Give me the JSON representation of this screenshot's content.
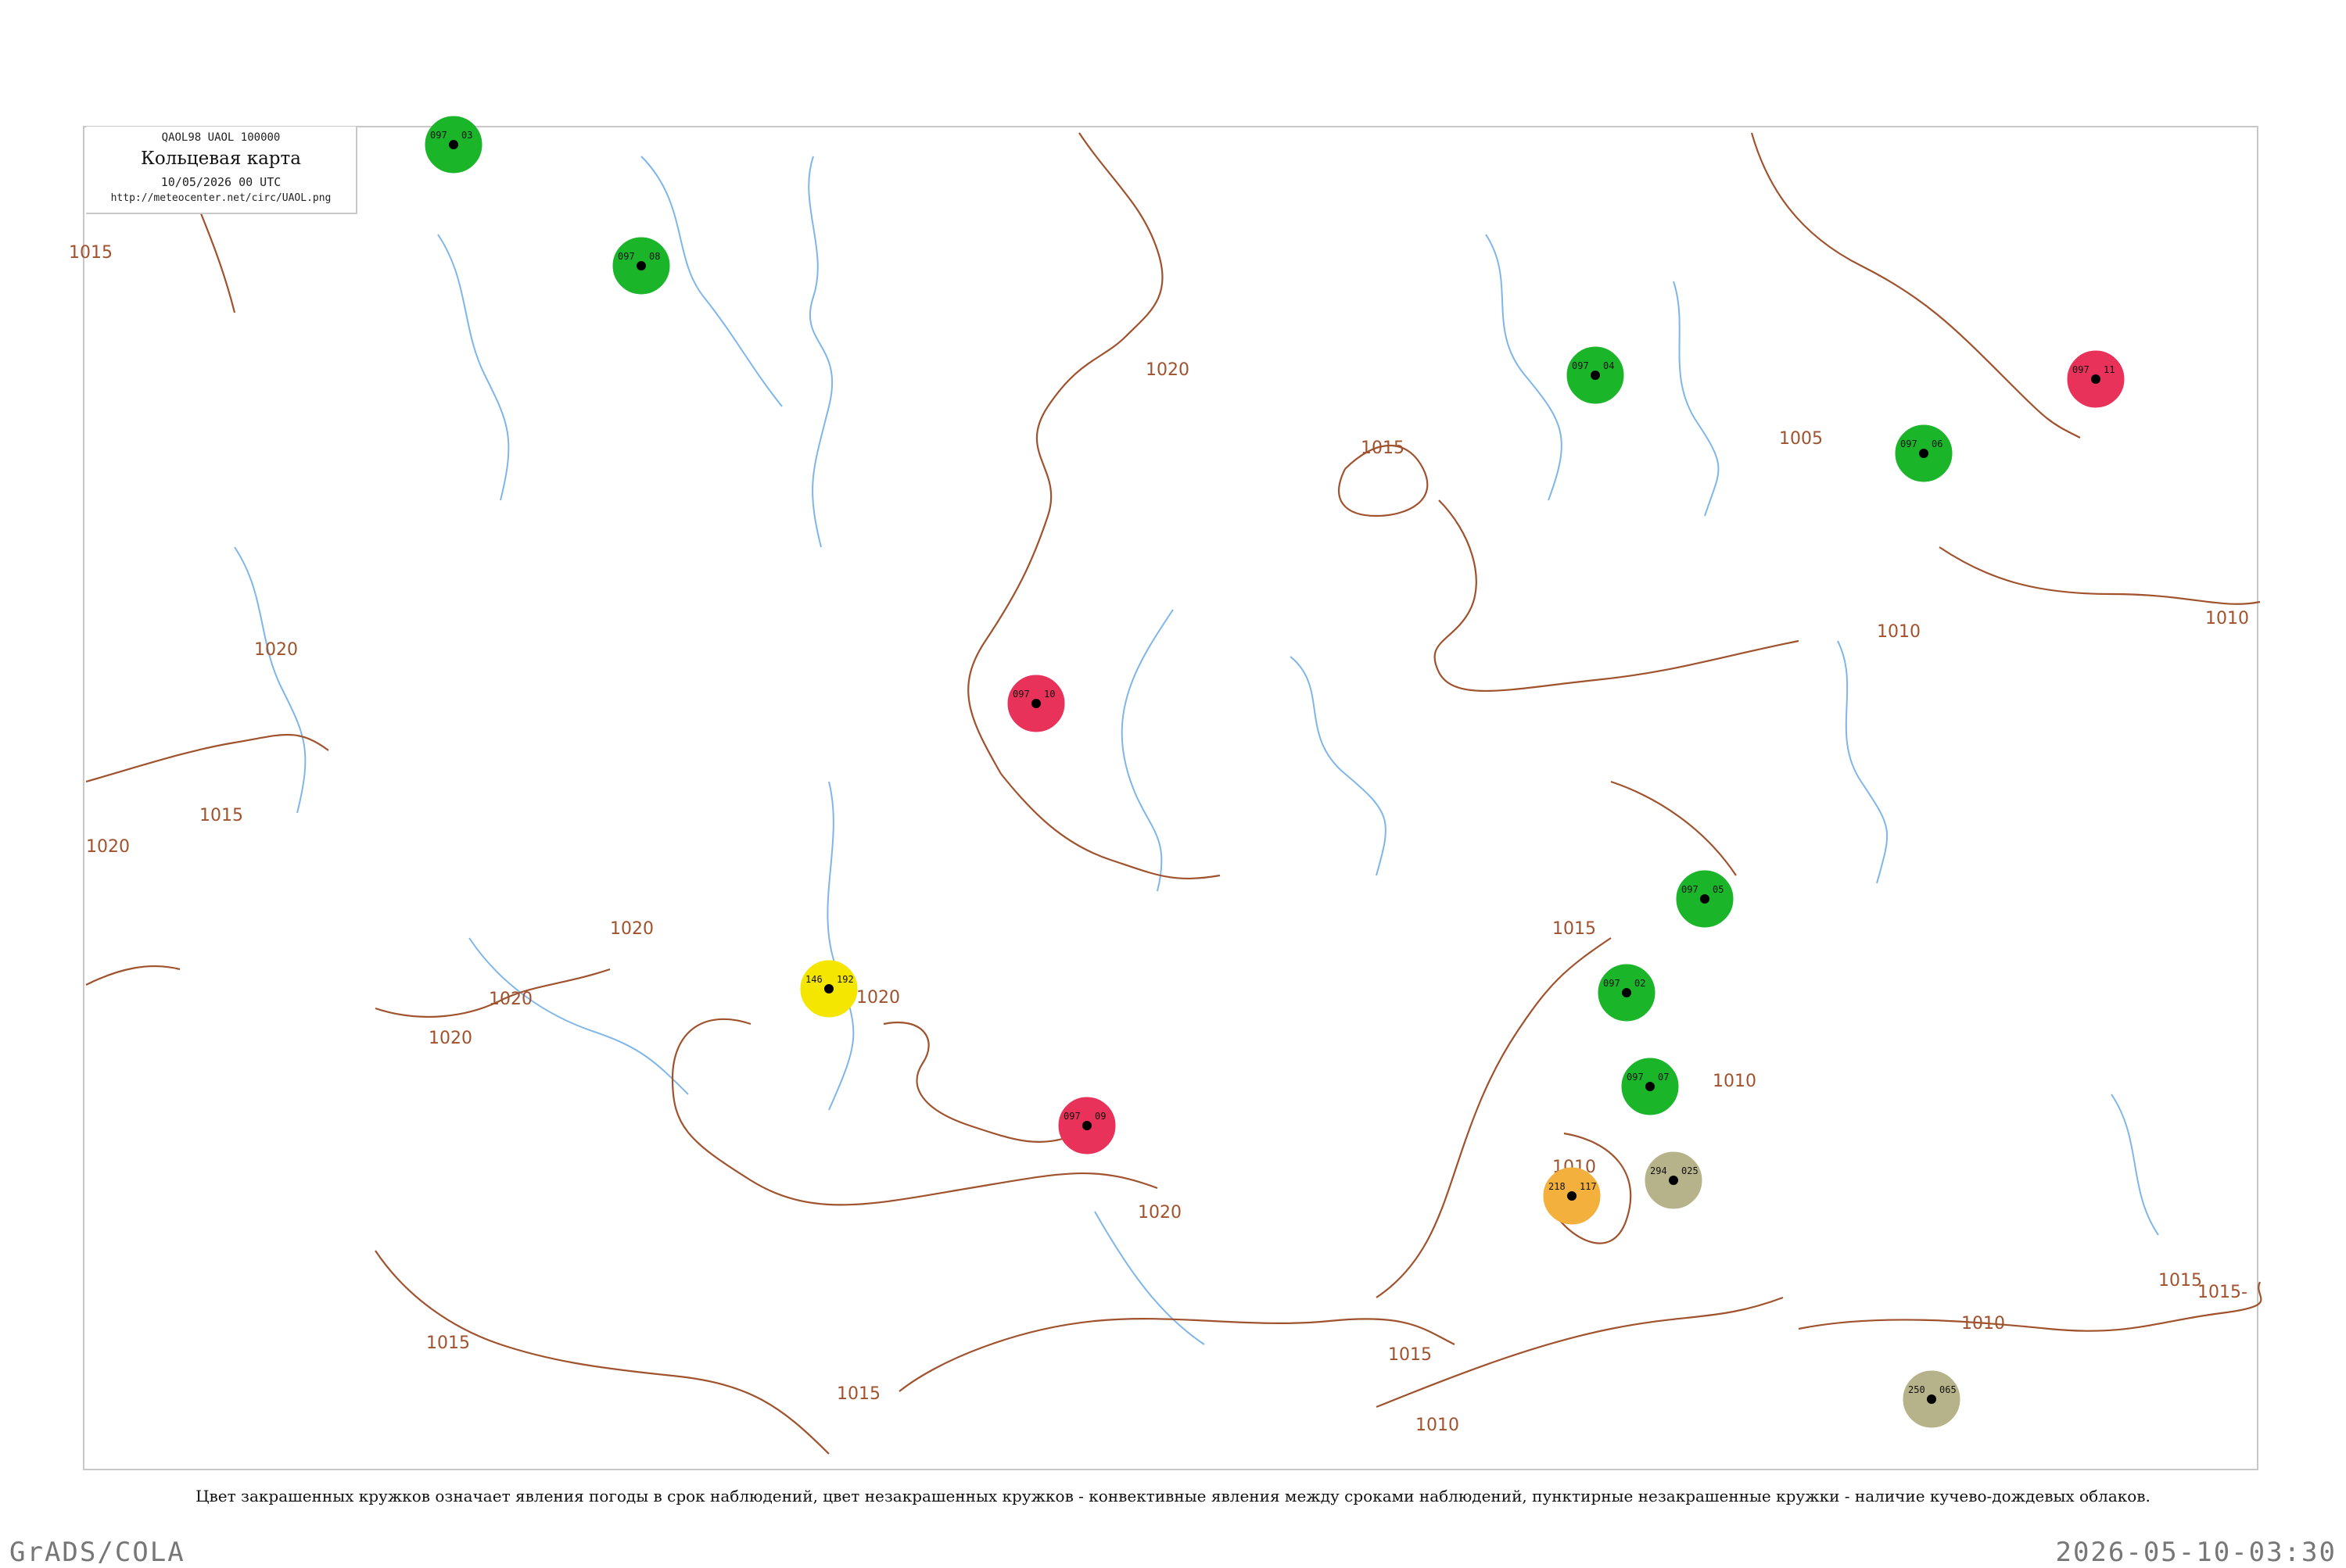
{
  "header": {
    "codes": "QAOL98  UAOL  100000",
    "title": "Кольцевая карта",
    "timestamp": "10/05/2026 00 UTC",
    "url": "http://meteocenter.net/circ/UAOL.png"
  },
  "caption": "Цвет закрашенных кружков означает явления погоды в срок наблюдений, цвет незакрашенных кружков - конвективные явления между сроками наблюдений, пунктирные незакрашенные кружки - наличие кучево-дождевых облаков.",
  "footer": {
    "left": "GrADS/COLA",
    "right": "2026-05-10-03:30"
  },
  "colors": {
    "isobar": "#a0522d",
    "river": "#7fb6ea",
    "rain": "#1bb52a",
    "thunder": "#e8325a",
    "fog": "#f5e600",
    "haze": "#f4b03c",
    "dust": "#b6b289",
    "frame": "#cccccc"
  },
  "isobar_labels": [
    "1015",
    "1015",
    "1015",
    "1015",
    "1015",
    "1015",
    "1015",
    "1015",
    "1020",
    "1020",
    "1020",
    "1020",
    "1020",
    "1020",
    "1020",
    "1020",
    "1010",
    "1010",
    "1010",
    "1010",
    "1010",
    "1010",
    "1005",
    "1015-"
  ],
  "stations": [
    {
      "id": "w1",
      "type": "rain",
      "p": "097",
      "t": "03"
    },
    {
      "id": "w2",
      "type": "rain",
      "p": "097",
      "t": "08"
    },
    {
      "id": "w3",
      "type": "rain",
      "p": "097",
      "t": "04"
    },
    {
      "id": "w4",
      "type": "rain",
      "p": "097",
      "t": "06"
    },
    {
      "id": "w5",
      "type": "rain",
      "p": "097",
      "t": "05"
    },
    {
      "id": "w6",
      "type": "rain",
      "p": "097",
      "t": "02"
    },
    {
      "id": "w7",
      "type": "rain",
      "p": "097",
      "t": "07"
    },
    {
      "id": "w8",
      "type": "thunder",
      "p": "097",
      "t": "10"
    },
    {
      "id": "w9",
      "type": "thunder",
      "p": "097",
      "t": "09"
    },
    {
      "id": "w10",
      "type": "thunder",
      "p": "097",
      "t": "11"
    },
    {
      "id": "w11",
      "type": "fog",
      "p": "146",
      "t": "192"
    },
    {
      "id": "w12",
      "type": "haze",
      "p": "218",
      "t": "117"
    },
    {
      "id": "w13",
      "type": "dust",
      "p": "294",
      "t": "025"
    },
    {
      "id": "w14",
      "type": "dust",
      "p": "250",
      "t": "065"
    }
  ]
}
